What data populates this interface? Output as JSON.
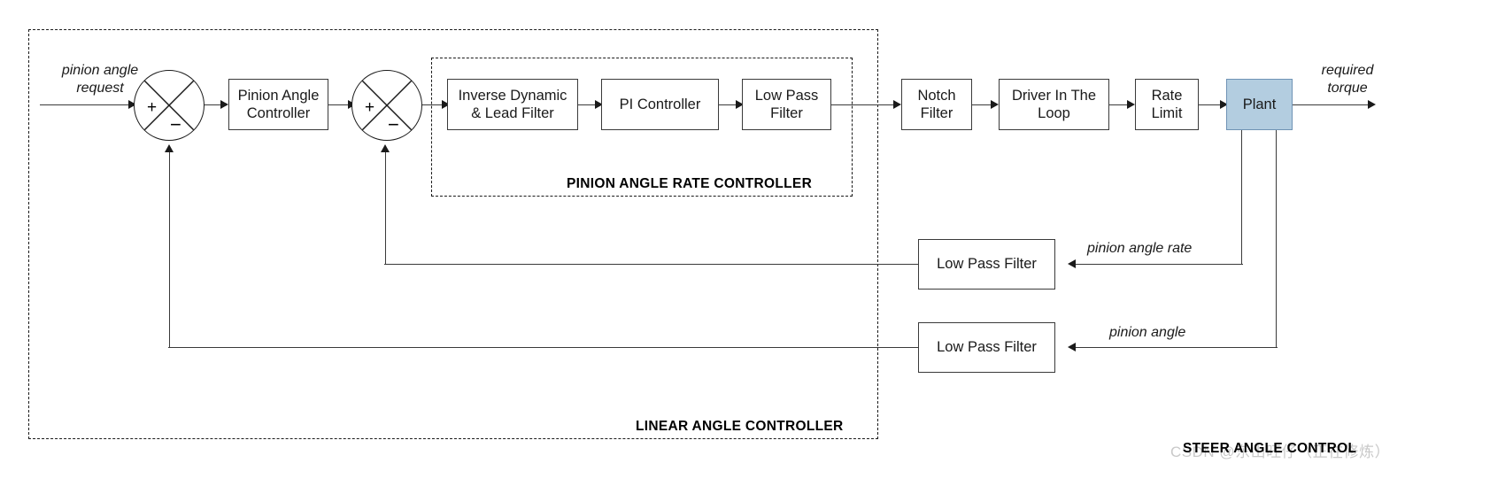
{
  "diagram": {
    "title": "Steer Angle Control",
    "outer_group_label": "LINEAR ANGLE CONTROLLER",
    "inner_group_label": "PINION ANGLE RATE CONTROLLER",
    "corner_title": "STEER ANGLE CONTROL",
    "watermark": "CSDN @东山旺仔（正在修炼）"
  },
  "signals": {
    "input": "pinion angle\nrequest",
    "output": "required\ntorque",
    "feedback_rate": "pinion angle rate",
    "feedback_angle": "pinion angle"
  },
  "summing_junctions": [
    {
      "name": "outer-sum",
      "plus": "+",
      "minus": "−"
    },
    {
      "name": "inner-sum",
      "plus": "+",
      "minus": "−"
    }
  ],
  "blocks": [
    {
      "name": "pinion-angle-controller",
      "label": "Pinion Angle\nController"
    },
    {
      "name": "inverse-dynamic-lead-filter",
      "label": "Inverse Dynamic\n& Lead Filter"
    },
    {
      "name": "pi-controller",
      "label": "PI Controller"
    },
    {
      "name": "low-pass-filter-inner",
      "label": "Low Pass\nFilter"
    },
    {
      "name": "notch-filter",
      "label": "Notch\nFilter"
    },
    {
      "name": "driver-in-the-loop",
      "label": "Driver In The\nLoop"
    },
    {
      "name": "rate-limit",
      "label": "Rate\nLimit"
    },
    {
      "name": "plant",
      "label": "Plant"
    },
    {
      "name": "low-pass-filter-rate",
      "label": "Low Pass Filter"
    },
    {
      "name": "low-pass-filter-angle",
      "label": "Low Pass Filter"
    }
  ],
  "colors": {
    "plant_fill": "#b3cde0",
    "plant_border": "#6f93b5",
    "line": "#3a3a3a",
    "dashed": "#1a1a1a",
    "watermark": "#c9c9c9"
  }
}
